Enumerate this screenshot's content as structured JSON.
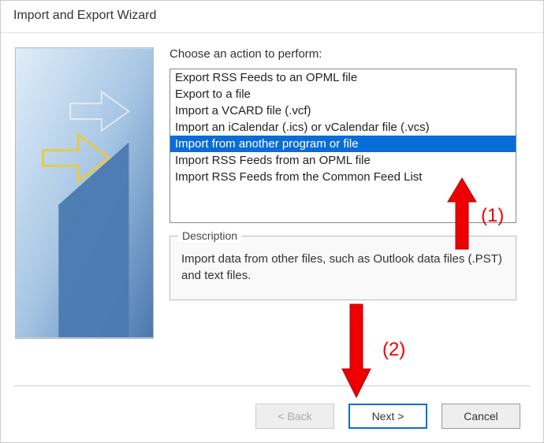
{
  "window": {
    "title": "Import and Export Wizard"
  },
  "prompt": "Choose an action to perform:",
  "actions": [
    {
      "label": "Export RSS Feeds to an OPML file",
      "selected": false
    },
    {
      "label": "Export to a file",
      "selected": false
    },
    {
      "label": "Import a VCARD file (.vcf)",
      "selected": false
    },
    {
      "label": "Import an iCalendar (.ics) or vCalendar file (.vcs)",
      "selected": false
    },
    {
      "label": "Import from another program or file",
      "selected": true
    },
    {
      "label": "Import RSS Feeds from an OPML file",
      "selected": false
    },
    {
      "label": "Import RSS Feeds from the Common Feed List",
      "selected": false
    }
  ],
  "description": {
    "legend": "Description",
    "text": "Import data from other files, such as Outlook data files (.PST) and text files."
  },
  "buttons": {
    "back": "< Back",
    "next": "Next >",
    "cancel": "Cancel"
  },
  "annotations": {
    "label1": "(1)",
    "label2": "(2)"
  }
}
